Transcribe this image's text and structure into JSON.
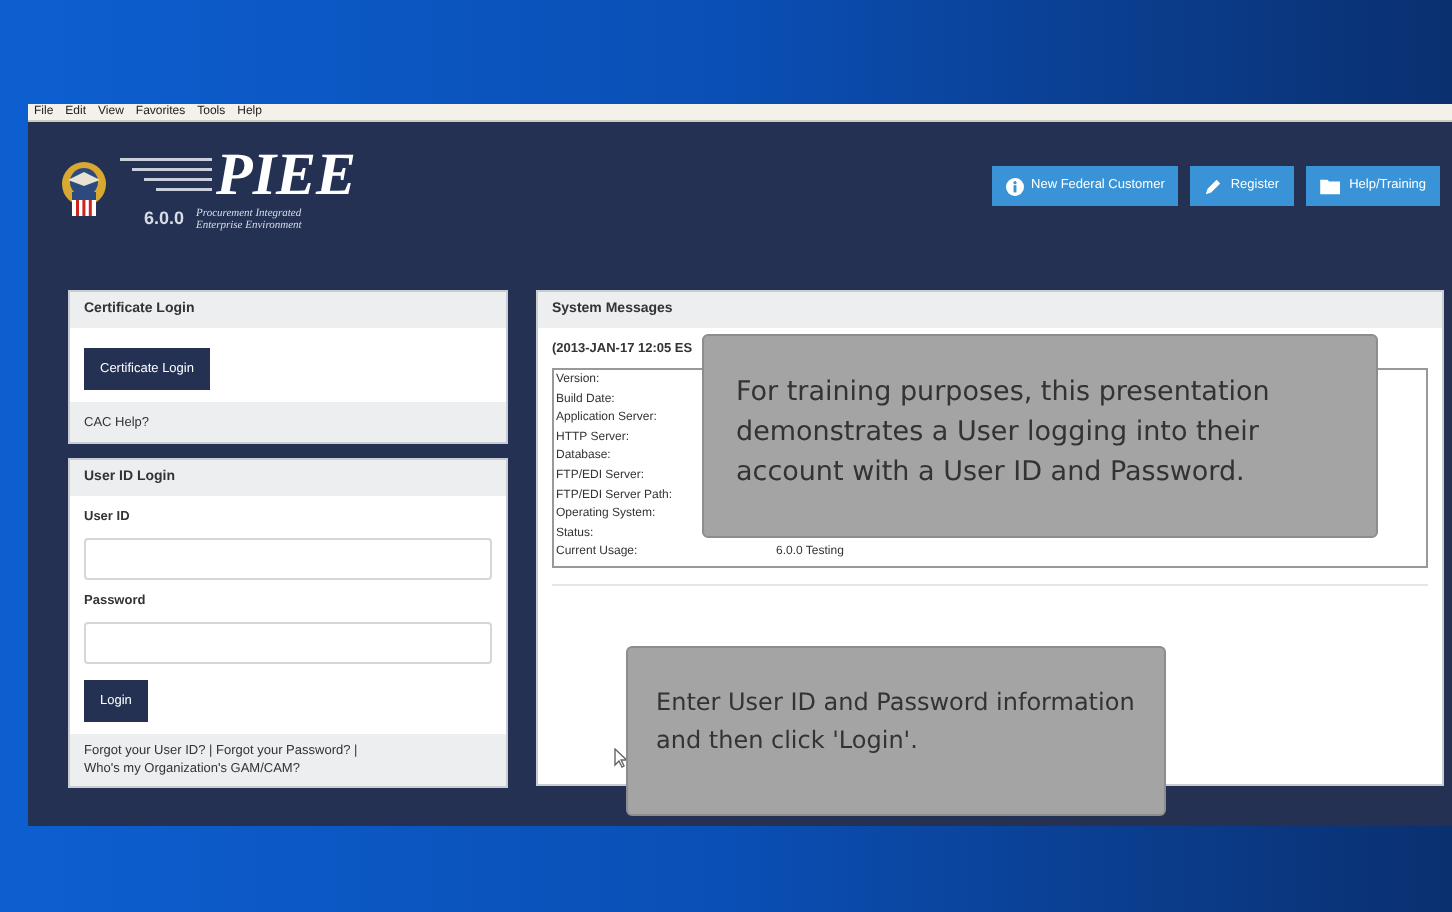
{
  "menu_bar": [
    "File",
    "Edit",
    "View",
    "Favorites",
    "Tools",
    "Help"
  ],
  "header": {
    "logo_title": "PIEE",
    "version": "6.0.0",
    "logo_subtitle": [
      "Procurement Integrated",
      "Enterprise Environment"
    ],
    "buttons": [
      {
        "label": "New Federal Customer",
        "kind": "info"
      },
      {
        "label": "Register",
        "kind": "pencil"
      },
      {
        "label": "Help/Training",
        "kind": "folder"
      }
    ]
  },
  "certificate_login": {
    "title": "Certificate Login",
    "button": "Certificate Login",
    "help_link": "CAC Help?"
  },
  "user_id_login": {
    "title": "User ID Login",
    "fields": [
      {
        "label": "User ID"
      },
      {
        "label": "Password"
      }
    ],
    "button": "Login",
    "links": [
      "Forgot your User ID?",
      "Forgot your Password?",
      "Who's my Organization's GAM/CAM?"
    ],
    "link_separator": "|"
  },
  "system_messages": {
    "title": "System Messages",
    "timestamp": "(2013-JAN-17 12:05 ES",
    "rows": [
      {
        "label": "Version:"
      },
      {
        "label": "Build Date:"
      },
      {
        "label": "Application Server:"
      },
      {
        "label": "HTTP Server:"
      },
      {
        "label": "Database:"
      },
      {
        "label": "FTP/EDI Server:"
      },
      {
        "label": "FTP/EDI Server Path:"
      },
      {
        "label": "Operating System:"
      },
      {
        "label": "Status:"
      },
      {
        "label": "Current Usage:",
        "value": "6.0.0 Testing"
      }
    ]
  },
  "callouts": [
    "For training purposes, this presentation demonstrates a User logging into their account with a User ID and Password.",
    "Enter User ID and Password information and then click 'Login'."
  ]
}
